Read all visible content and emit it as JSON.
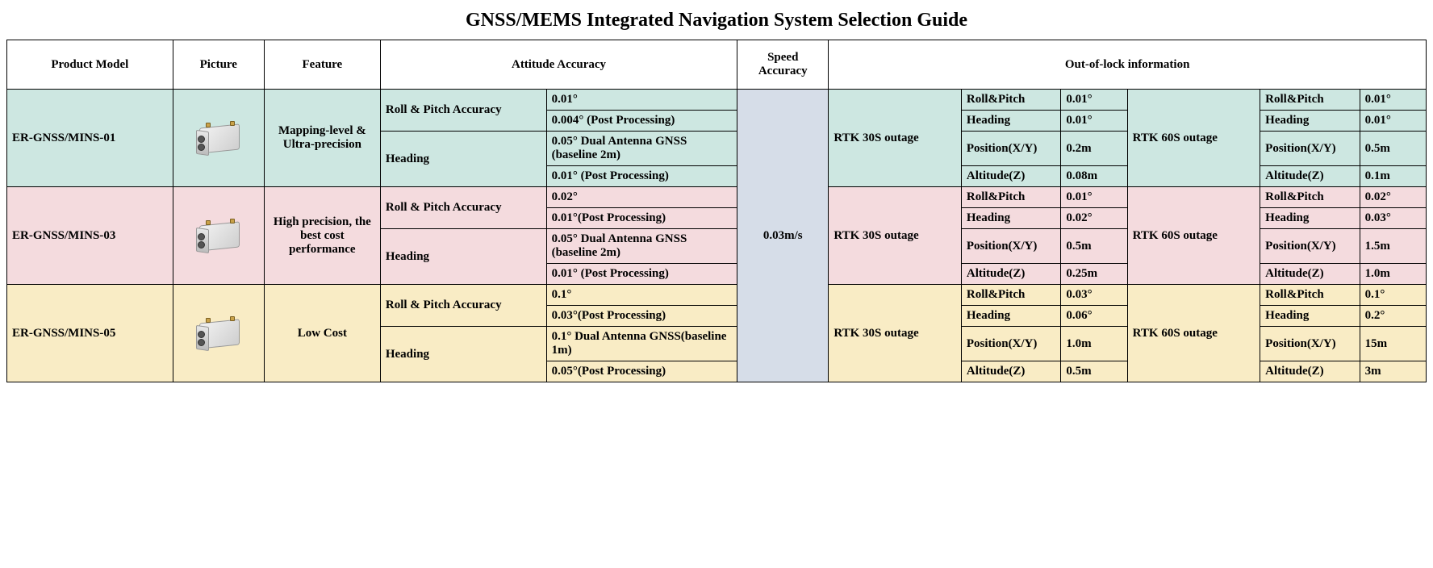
{
  "title": "GNSS/MEMS Integrated Navigation System Selection Guide",
  "headers": {
    "model": "Product Model",
    "picture": "Picture",
    "feature": "Feature",
    "attitude": "Attitude Accuracy",
    "speed": "Speed Accuracy",
    "outoflock": "Out-of-lock information"
  },
  "speed_value": "0.03m/s",
  "labels": {
    "roll_pitch_acc": "Roll & Pitch Accuracy",
    "heading": "Heading",
    "rtk30": "RTK 30S outage",
    "rtk60": "RTK 60S outage",
    "roll_pitch": "Roll&Pitch",
    "heading_s": "Heading",
    "posxy": "Position(X/Y)",
    "altz": "Altitude(Z)"
  },
  "products": [
    {
      "model": "ER-GNSS/MINS-01",
      "feature": "Mapping-level & Ultra-precision",
      "att": {
        "rp": "0.01°",
        "rpp": "0.004° (Post Processing)",
        "hd": "0.05° Dual Antenna GNSS (baseline 2m)",
        "hdp": "0.01° (Post Processing)"
      },
      "r30": {
        "rp": "0.01°",
        "hd": "0.01°",
        "pos": "0.2m",
        "alt": "0.08m"
      },
      "r60": {
        "rp": "0.01°",
        "hd": "0.01°",
        "pos": "0.5m",
        "alt": "0.1m"
      }
    },
    {
      "model": "ER-GNSS/MINS-03",
      "feature": "High precision, the best cost performance",
      "att": {
        "rp": "0.02°",
        "rpp": "0.01°(Post Processing)",
        "hd": "0.05° Dual Antenna GNSS (baseline 2m)",
        "hdp": "0.01° (Post Processing)"
      },
      "r30": {
        "rp": "0.01°",
        "hd": "0.02°",
        "pos": "0.5m",
        "alt": "0.25m"
      },
      "r60": {
        "rp": "0.02°",
        "hd": "0.03°",
        "pos": "1.5m",
        "alt": "1.0m"
      }
    },
    {
      "model": "ER-GNSS/MINS-05",
      "feature": "Low Cost",
      "att": {
        "rp": "0.1°",
        "rpp": "0.03°(Post Processing)",
        "hd": "0.1° Dual Antenna GNSS(baseline 1m)",
        "hdp": "0.05°(Post Processing)"
      },
      "r30": {
        "rp": "0.03°",
        "hd": "0.06°",
        "pos": "1.0m",
        "alt": "0.5m"
      },
      "r60": {
        "rp": "0.1°",
        "hd": "0.2°",
        "pos": "15m",
        "alt": "3m"
      }
    }
  ]
}
